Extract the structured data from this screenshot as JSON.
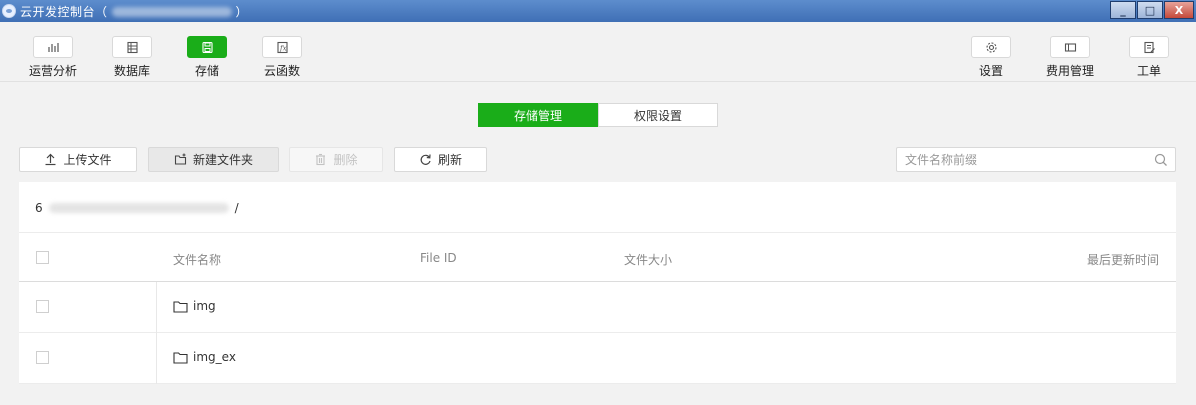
{
  "titlebar": {
    "title_prefix": "云开发控制台（",
    "title_suffix": "）",
    "controls": [
      "_",
      "□",
      "X"
    ]
  },
  "toolbar": {
    "left": [
      {
        "label": "运营分析",
        "icon": "bar-chart-icon"
      },
      {
        "label": "数据库",
        "icon": "database-icon"
      },
      {
        "label": "存储",
        "icon": "storage-icon"
      },
      {
        "label": "云函数",
        "icon": "function-icon"
      }
    ],
    "right": [
      {
        "label": "设置",
        "icon": "gear-icon"
      },
      {
        "label": "费用管理",
        "icon": "wallet-icon"
      },
      {
        "label": "工单",
        "icon": "ticket-icon"
      }
    ]
  },
  "tabs": [
    {
      "label": "存储管理",
      "active": true
    },
    {
      "label": "权限设置",
      "active": false
    }
  ],
  "actions": {
    "upload": "上传文件",
    "new_folder": "新建文件夹",
    "delete": "删除",
    "refresh": "刷新"
  },
  "search": {
    "placeholder": "文件名称前缀",
    "value": ""
  },
  "path": {
    "prefix": "6",
    "separator": "/"
  },
  "table": {
    "columns": [
      "文件名称",
      "File ID",
      "文件大小",
      "最后更新时间"
    ],
    "rows": [
      {
        "name": "img",
        "type": "folder"
      },
      {
        "name": "img_ex",
        "type": "folder"
      }
    ]
  },
  "colors": {
    "accent": "#1aad19",
    "titlebar": "#4a7bc0"
  }
}
